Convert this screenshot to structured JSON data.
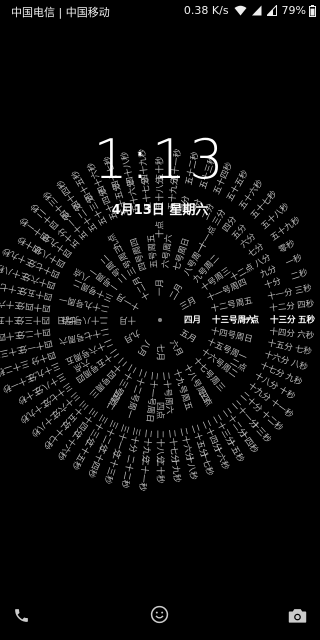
{
  "status_bar": {
    "carriers": "中国电信 | 中国移动",
    "net_speed": "0.38 K/s",
    "battery": "79%"
  },
  "lock_screen": {
    "time": "1:13",
    "date": "4月13日 星期六"
  },
  "text_clock": {
    "current": {
      "month": "四月",
      "day_weekday": "十三号周六",
      "hour": "一点",
      "minute": "十三分",
      "second": "五秒"
    },
    "rings": {
      "month": [
        "一月",
        "二月",
        "三月",
        "四月",
        "五月",
        "六月",
        "七月",
        "八月",
        "九月",
        "十月",
        "十一月",
        "十二月"
      ],
      "day": [
        "一号周一",
        "二号周二",
        "三号周三",
        "四号周四",
        "五号周五",
        "六号周六",
        "七号周日",
        "八号周一",
        "九号周二",
        "十号周三",
        "十一号周四",
        "十二号周五",
        "十三号周六",
        "十四号周日",
        "十五号周一",
        "十六号周二",
        "十七号周三",
        "十八号周四",
        "十九号周五",
        "二十号周六",
        "二十一号周日",
        "二十二号周一",
        "二十三号周二",
        "二十四号周三",
        "二十五号周四",
        "二十六号周五",
        "二十七号周六",
        "二十八号周日",
        "二十九号周一",
        "三十号周二"
      ],
      "hour": [
        "一点",
        "二点",
        "三点",
        "四点",
        "五点",
        "六点",
        "七点",
        "八点",
        "九点",
        "十点",
        "十一点",
        "十二点"
      ],
      "minute": [
        "一分",
        "二分",
        "三分",
        "四分",
        "五分",
        "六分",
        "七分",
        "八分",
        "九分",
        "十分",
        "十一分",
        "十二分",
        "十三分",
        "十四分",
        "十五分",
        "十六分",
        "十七分",
        "十八分",
        "十九分",
        "二十分",
        "二十一分",
        "二十二分",
        "二十三分",
        "二十四分",
        "二十五分",
        "二十六分",
        "二十七分",
        "二十八分",
        "二十九分",
        "三十分",
        "三十一分",
        "三十二分",
        "三十三分",
        "三十四分",
        "三十五分",
        "三十六分",
        "三十七分",
        "三十八分",
        "三十九分",
        "四十分",
        "四十一分",
        "四十二分",
        "四十三分",
        "四十四分",
        "四十五分",
        "四十六分",
        "四十七分",
        "四十八分",
        "四十九分",
        "五十分",
        "五十一分",
        "五十二分",
        "五十三分",
        "五十四分",
        "五十五分",
        "五十六分",
        "五十七分",
        "五十八分",
        "五十九分",
        "零分"
      ],
      "second": [
        "一秒",
        "二秒",
        "三秒",
        "四秒",
        "五秒",
        "六秒",
        "七秒",
        "八秒",
        "九秒",
        "十秒",
        "十一秒",
        "十二秒",
        "十三秒",
        "十四秒",
        "十五秒",
        "十六秒",
        "十七秒",
        "十八秒",
        "十九秒",
        "二十秒",
        "二十一秒",
        "二十二秒",
        "二十三秒",
        "二十四秒",
        "二十五秒",
        "二十六秒",
        "二十七秒",
        "二十八秒",
        "二十九秒",
        "三十秒",
        "三十一秒",
        "三十二秒",
        "三十三秒",
        "三十四秒",
        "三十五秒",
        "三十六秒",
        "三十七秒",
        "三十八秒",
        "三十九秒",
        "四十秒",
        "四十一秒",
        "四十二秒",
        "四十三秒",
        "四十四秒",
        "四十五秒",
        "四十六秒",
        "四十七秒",
        "四十八秒",
        "四十九秒",
        "五十秒",
        "五十一秒",
        "五十二秒",
        "五十三秒",
        "五十四秒",
        "五十五秒",
        "五十六秒",
        "五十七秒",
        "五十八秒",
        "五十九秒",
        "零秒"
      ]
    }
  },
  "bottom_bar": {
    "left_icon": "phone-icon",
    "center_icon": "smiley-icon",
    "right_icon": "camera-icon"
  }
}
